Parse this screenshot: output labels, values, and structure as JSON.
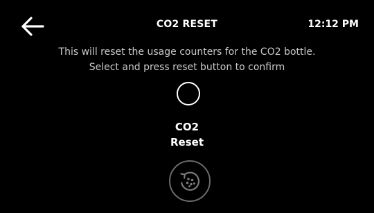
{
  "header": {
    "back_icon": "arrow-left-icon",
    "title": "CO2 RESET",
    "time": "12:12 PM"
  },
  "main": {
    "description_line1": "This will reset the usage counters for the CO2 bottle.",
    "description_line2": "Select and press reset button to confirm",
    "option": {
      "label_line1": "CO2",
      "label_line2": "Reset",
      "selected": false
    },
    "reset_button": {
      "icon": "reset-icon"
    }
  },
  "colors": {
    "background": "#000000",
    "text": "#ffffff",
    "description_text": "#c9c9c9",
    "button_border": "#6a6a6a"
  }
}
